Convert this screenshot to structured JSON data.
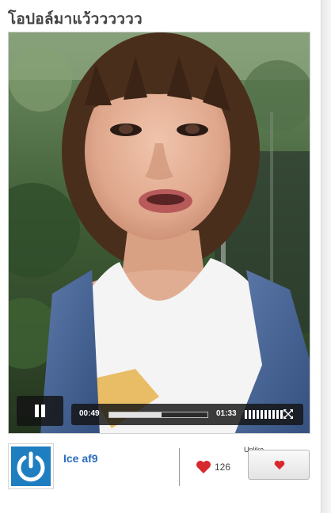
{
  "post": {
    "title": "โอปอล์มาแว้วววววว"
  },
  "player": {
    "play_state_icon": "pause-icon",
    "current_time": "00:49",
    "duration": "01:33",
    "progress_fraction": 0.53,
    "volume_level_fraction": 1.0,
    "fullscreen_icon": "fullscreen-icon"
  },
  "author": {
    "username": "Ice af9",
    "avatar_icon": "power-icon",
    "avatar_color": "#1f7ec0"
  },
  "likes": {
    "count": "126",
    "heart_color": "#d8282f",
    "unlike_label": "Unlike",
    "unlike_icon": "heart-icon"
  }
}
